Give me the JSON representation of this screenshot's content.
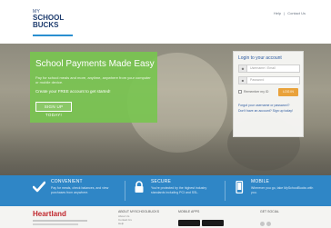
{
  "header": {
    "logo": {
      "line1": "MY",
      "line2": "SCHOOL",
      "line3": "BUCKS"
    },
    "links": [
      "Help",
      "|",
      "Contact Us"
    ]
  },
  "promo": {
    "title": "School Payments Made Easy",
    "subtitle": "Pay for school meals and more, anytime, anywhere from your computer or mobile device.",
    "create": "Create your FREE account to get started!",
    "signup": "SIGN UP TODAY!"
  },
  "login": {
    "title": "Login to your account",
    "username_placeholder": "Username / Email",
    "password_placeholder": "Password",
    "remember_label": "Remember my ID",
    "button": "LOG IN",
    "forgot_link": "Forgot your username or password?",
    "help_link": "Don't have an account? Sign up today!"
  },
  "features": [
    {
      "title": "CONVENIENT",
      "desc": "Pay for meals, check balances, and view purchases from anywhere."
    },
    {
      "title": "SECURE",
      "desc": "You're protected by the highest industry standards including PCI and SSL."
    },
    {
      "title": "MOBILE",
      "desc": "Wherever you go, take MySchoolBucks with you."
    }
  ],
  "footer": {
    "brand": "Heartland",
    "about": {
      "heading": "ABOUT MYSCHOOLBUCKS",
      "links": [
        "About Us",
        "Contact Us",
        "Help",
        "Privacy Policy"
      ]
    },
    "apps": {
      "heading": "MOBILE APPS"
    },
    "social": {
      "heading": "GET SOCIAL"
    }
  },
  "colors": {
    "accent_green": "#78c450",
    "band_blue": "#2f86c6",
    "login_button": "#e9a23b",
    "brand_red": "#c0262c"
  }
}
